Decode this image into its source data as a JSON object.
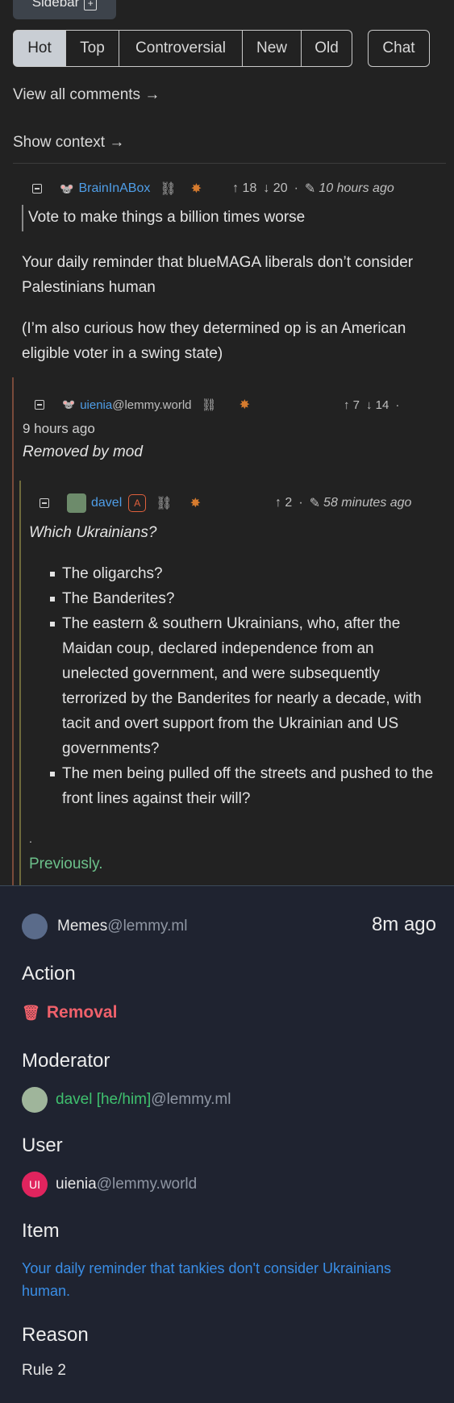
{
  "sidebar_button": "Sidebar",
  "sort_tabs": [
    "Hot",
    "Top",
    "Controversial",
    "New",
    "Old"
  ],
  "chat_button": "Chat",
  "view_all_comments": "View all comments →",
  "show_context": "Show context →",
  "comment1": {
    "author": "BrainInABox",
    "upvotes": "↑ 18",
    "downvotes": "↓ 20",
    "time": "10 hours ago",
    "quote": "Vote to make things a billion times worse",
    "paragraph1": "Your daily reminder that blueMAGA liberals don’t consider Palestinians human",
    "paragraph2": "(I’m also curious how they determined op is an American eligible voter in a swing state)"
  },
  "comment2": {
    "author": "uienia",
    "instance": "@lemmy.world",
    "upvotes": "↑ 7",
    "downvotes": "↓ 14",
    "dot": "·",
    "time": "9 hours ago",
    "removed_text": "Removed by mod"
  },
  "comment3": {
    "author": "davel",
    "mod_badge": "A",
    "upvotes": "↑ 2",
    "time": "58 minutes ago",
    "lead": "Which Ukrainians?",
    "bullets": [
      "The oligarchs?",
      "The Banderites?",
      "The eastern & southern Ukrainians, who, after the Maidan coup, declared independence from an unelected government, and were subsequently terrorized by the Banderites for nearly a decade, with tacit and overt support from the Ukrainian and US governments?",
      "The men being pulled off the streets and pushed to the front lines against their will?"
    ],
    "dot_line": ".",
    "previously": "Previously."
  },
  "modlog": {
    "community": "Memes",
    "community_instance": "@lemmy.ml",
    "time": "8m ago",
    "action_heading": "Action",
    "action_value": "Removal",
    "moderator_heading": "Moderator",
    "moderator_name": "davel [he/him]",
    "moderator_instance": "@lemmy.ml",
    "user_heading": "User",
    "user_avatar_text": "UI",
    "user_name": "uienia",
    "user_instance": "@lemmy.world",
    "item_heading": "Item",
    "item_text": "Your daily reminder that tankies don't consider Ukrainians human.",
    "reason_heading": "Reason",
    "reason_value": "Rule 2"
  },
  "colors": {
    "link_blue": "#4f9ee8",
    "green": "#6cc08a",
    "removal_red": "#f0616b",
    "user_badge": "#e0245e"
  }
}
